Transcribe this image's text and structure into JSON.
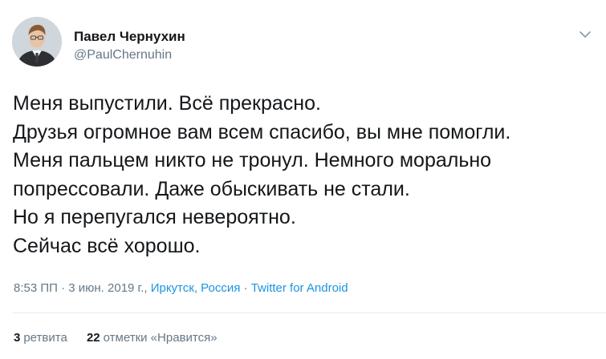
{
  "author": {
    "name": "Павел Чернухин",
    "handle": "@PaulChernuhin"
  },
  "tweet": {
    "lines": [
      "Меня выпустили. Всё прекрасно.",
      "Друзья огромное вам всем спасибо, вы мне помогли.",
      "Меня пальцем никто не тронул. Немного морально",
      "попрессовали. Даже обыскивать не стали.",
      "Но я перепугался невероятно.",
      "Сейчас всё хорошо."
    ]
  },
  "meta": {
    "time_date": "8:53 ПП · 3 июн. 2019 г.,",
    "location": "Иркутск, Россия",
    "separator": "·",
    "source": "Twitter for Android"
  },
  "stats": {
    "retweets_count": "3",
    "retweets_label": "ретвита",
    "likes_count": "22",
    "likes_label": "отметки «Нравится»"
  },
  "icons": {
    "caret": "chevron-down-icon"
  },
  "colors": {
    "link": "#1b95e0",
    "muted": "#657786",
    "text": "#14171a",
    "divider": "#e6ecf0"
  }
}
